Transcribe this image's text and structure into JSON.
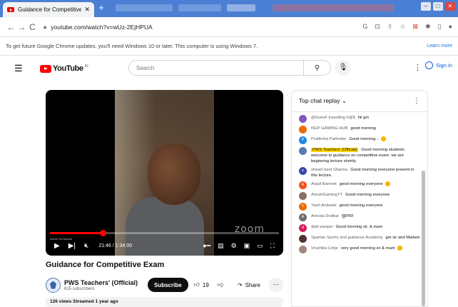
{
  "browser": {
    "tab_title": "Guidance for Competitive Exam",
    "tab_close": "✕",
    "new_tab": "+",
    "url": "youtube.com/watch?v=wUz-2EjHPUA",
    "banner_text": "To get future Google Chrome updates, you'll need Windows 10 or later. This computer is using Windows 7.",
    "banner_link": "Learn more",
    "accent": "#4a7fd4"
  },
  "youtube": {
    "logo_text": "YouTube",
    "logo_cc": "IN",
    "search_placeholder": "Search",
    "sign_in": "Sign in"
  },
  "player": {
    "time": "21:46 / 1:34:00",
    "progress": 0.23,
    "watermark": "zoom",
    "caption": "Ashok Sir Bharati"
  },
  "video": {
    "title": "Guidance for Competitive Exam",
    "channel_name": "PWS Teachers' (Official)",
    "subscribers": "615 subscribers",
    "subscribe_label": "Subscribe",
    "likes": "19",
    "share_label": "Share",
    "description_preview": "126 views  Streamed 1 year ago"
  },
  "chat": {
    "header": "Top chat replay",
    "messages": [
      {
        "author": "@SonuF travelling #@$",
        "text": "hii gm",
        "color": "#7e57c2",
        "initial": ""
      },
      {
        "author": "NGP GAMING HUB",
        "text": "good morning",
        "color": "#ef6c00",
        "initial": ""
      },
      {
        "author": "Pratiksha Pathrabe",
        "text": "Good morning...",
        "color": "#1e88e5",
        "initial": "P",
        "emoji": true
      },
      {
        "author": "PWS Teachers' (Official)",
        "text": "Good morning students. welcome to guidance on competitive exam. we are beginning lecture shortly.",
        "color": "#5a78b0",
        "initial": "",
        "owner": true
      },
      {
        "author": "shashi kant Sharma",
        "text": "Good morning everyone present in this lecture.",
        "color": "#3949ab",
        "initial": "s"
      },
      {
        "author": "Anjali Bamnet",
        "text": "good morning everyone",
        "color": "#f4511e",
        "initial": "A",
        "emoji": true
      },
      {
        "author": "AnoshGamingYT",
        "text": "Good morning everyone",
        "color": "#8d6e63",
        "initial": ""
      },
      {
        "author": "Yash Ambade",
        "text": "good morning everyone",
        "color": "#ef6c00",
        "initial": "Y"
      },
      {
        "author": "Amruta Dodkar",
        "text": "सुप्रभात",
        "color": "#6d6d6d",
        "initial": "A"
      },
      {
        "author": "dipti wanjari",
        "text": "Good morning sir, & mam",
        "color": "#d81b60",
        "initial": "d"
      },
      {
        "author": "Spartan Sports and guidance Academy",
        "text": "gm sir and Madam",
        "color": "#4e342e",
        "initial": ""
      },
      {
        "author": "Vrushika Limje",
        "text": "very good morning sir & mam",
        "color": "#a1887f",
        "initial": "",
        "emoji": true
      }
    ]
  }
}
